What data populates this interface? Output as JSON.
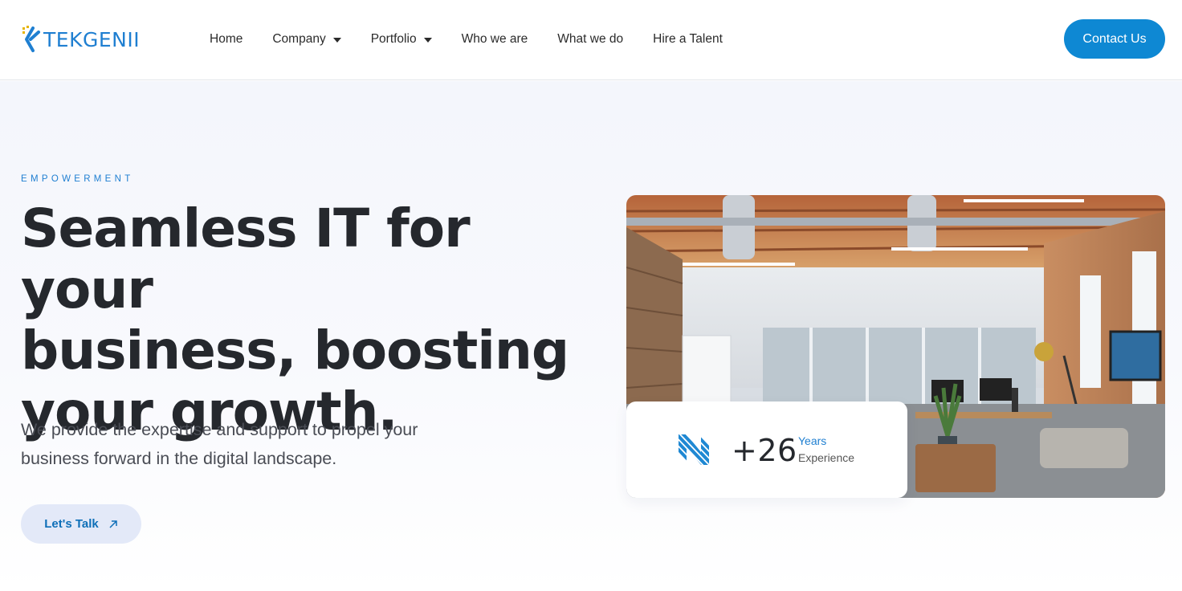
{
  "brand": {
    "name": "TEKGENII",
    "primary_color": "#1f7fd1",
    "accent_color": "#e6b400"
  },
  "nav": {
    "items": [
      {
        "label": "Home",
        "dropdown": false
      },
      {
        "label": "Company",
        "dropdown": true
      },
      {
        "label": "Portfolio",
        "dropdown": true
      },
      {
        "label": "Who we are",
        "dropdown": false
      },
      {
        "label": "What we do",
        "dropdown": false
      },
      {
        "label": "Hire a Talent",
        "dropdown": false
      }
    ],
    "cta_label": "Contact Us"
  },
  "hero": {
    "eyebrow": "EMPOWERMENT",
    "headline_lines": [
      "Seamless IT for your",
      "business, boosting",
      "your growth."
    ],
    "subtext_lines": [
      "We provide the expertise and support to propel your",
      "business forward in the digital landscape."
    ],
    "cta_label": "Let's Talk",
    "cta_icon": "arrow-up-right-icon",
    "image": "office-interior-photo"
  },
  "stat": {
    "icon": "striped-n-logo-icon",
    "value": "+26",
    "label_top": "Years",
    "label_bottom": "Experience"
  }
}
